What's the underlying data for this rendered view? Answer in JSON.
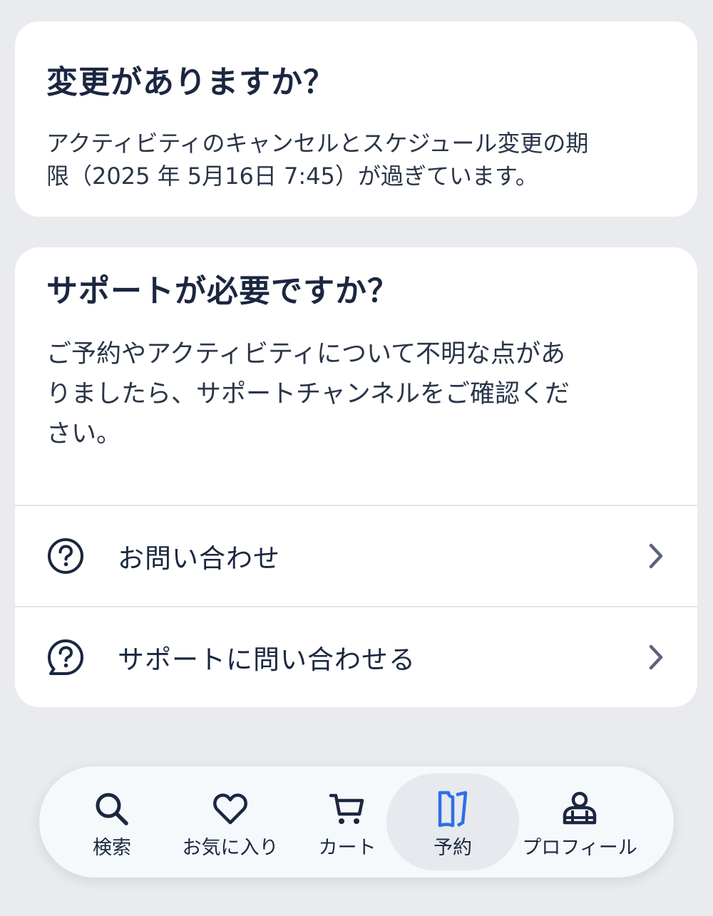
{
  "change_card": {
    "title": "変更がありますか？",
    "text_line1": "アクティビティのキャンセルとスケジュール変更の期",
    "text_line2": "限（2025 年 5月16日 7:45）が過ぎています。"
  },
  "support_card": {
    "title": "サポートが必要ですか？",
    "text_line1": "ご予約やアクティビティについて不明な点があ",
    "text_line2": "りましたら、サポートチャンネルをご確認くだ",
    "text_line3": "さい。",
    "rows": [
      {
        "label": "お問い合わせ",
        "icon": "question-circle-icon"
      },
      {
        "label": "サポートに問い合わせる",
        "icon": "question-bubble-icon"
      }
    ]
  },
  "nav": {
    "items": [
      {
        "label": "検索",
        "icon": "search-icon"
      },
      {
        "label": "お気に入り",
        "icon": "heart-icon"
      },
      {
        "label": "カート",
        "icon": "cart-icon"
      },
      {
        "label": "予約",
        "icon": "ticket-icon",
        "active": true
      },
      {
        "label": "プロフィール",
        "icon": "profile-icon"
      }
    ],
    "active_color": "#2f6fe6"
  }
}
